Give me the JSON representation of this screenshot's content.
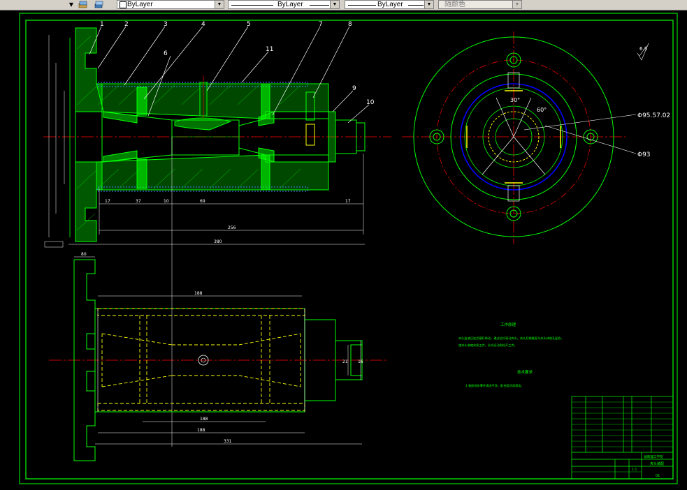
{
  "toolbar": {
    "layer_label": "ByLayer",
    "linetype_label": "ByLayer",
    "lineweight_label": "ByLayer",
    "color_label": "随颜色"
  },
  "drawing": {
    "part_numbers": [
      "1",
      "2",
      "3",
      "4",
      "5",
      "6",
      "7",
      "8",
      "9",
      "10",
      "11"
    ],
    "roughness_symbol": "6.3",
    "diameter_callout_1": "Φ95.57.02",
    "diameter_callout_2": "Φ93",
    "angle_1": "30°",
    "angle_2": "60°",
    "dimensions": {
      "d17a": "17",
      "d37": "37",
      "d10": "10",
      "d69": "69",
      "d17b": "17",
      "d256": "256",
      "d380": "380",
      "d188": "188",
      "d188b": "188",
      "d331": "331",
      "d80": "80",
      "d21": "21",
      "d16": "16"
    },
    "notes_title": "工作原理",
    "notes_body_1": "夹头由液压缸活塞杆带动，通过拉杆驱动夹头。夹头后端锥面与夹头体锥孔配合，",
    "notes_body_2": "使夹头收缩夹紧工件，反向运动则松开工件。",
    "tech_title": "技术要求",
    "tech_body": "1.装配前各零件清洗干净，配合面涂润滑油。",
    "title_block": {
      "school": "湖南理工学院",
      "drawing_name": "夹头装配",
      "scale": "1:1",
      "sheet": "01"
    }
  },
  "colors": {
    "drawing_bg": "#000000",
    "outline": "#00ff00",
    "hatch": "#00ff00",
    "hidden": "#ffff00",
    "center": "#ff0000",
    "dim": "#ffffff",
    "blue_circle": "#0000ff",
    "toolbar_bg": "#d4d0c8"
  }
}
